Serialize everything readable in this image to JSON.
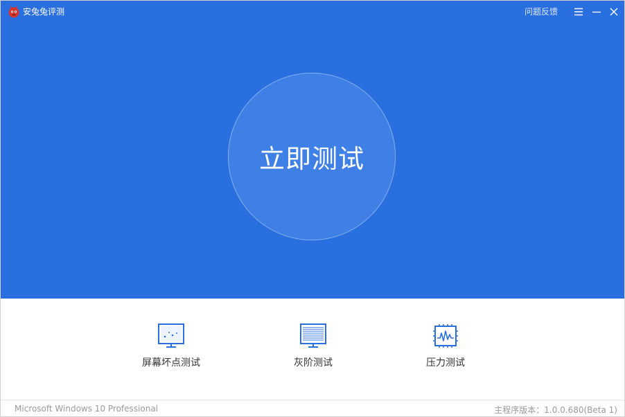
{
  "app": {
    "title": "安兔兔评测",
    "logo_icon": "antutu-logo-icon"
  },
  "titlebar": {
    "feedback_label": "问题反馈",
    "menu_icon": "hamburger-menu-icon",
    "minimize_icon": "minimize-icon",
    "close_icon": "close-icon"
  },
  "hero": {
    "start_button_label": "立即测试"
  },
  "tools": [
    {
      "label": "屏幕坏点测试",
      "icon": "dead-pixel-monitor-icon"
    },
    {
      "label": "灰阶测试",
      "icon": "grayscale-monitor-icon"
    },
    {
      "label": "压力测试",
      "icon": "stress-chip-icon"
    }
  ],
  "statusbar": {
    "os": "Microsoft Windows 10 Professional",
    "version": "主程序版本：1.0.0.680(Beta 1)"
  },
  "colors": {
    "hero_background": "#2a6fe0",
    "circle_fill": "#3f80e6",
    "icon_blue": "#2a6fe0",
    "tool_text": "#333333",
    "status_text": "#9a9a9a"
  }
}
